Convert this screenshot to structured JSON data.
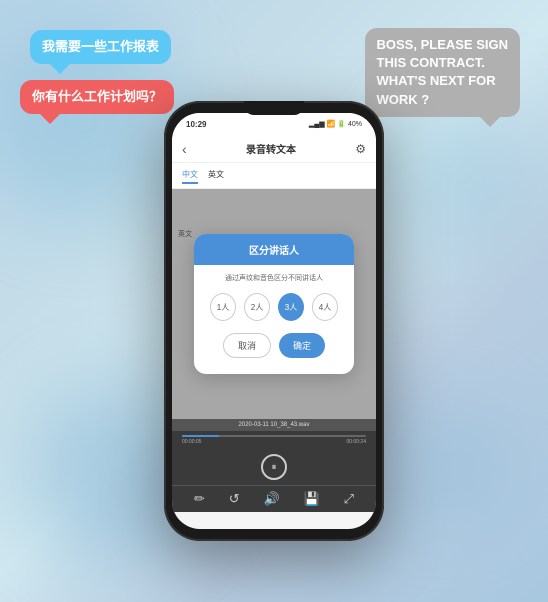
{
  "background": {
    "colors": [
      "#b8d4e8",
      "#c5dde8",
      "#d0e8f0"
    ]
  },
  "bubbles": {
    "left1": {
      "text": "我需要一些工作报表",
      "color": "#5bc8f5"
    },
    "left2": {
      "text": "你有什么工作计划吗？",
      "color": "#f06060"
    },
    "right": {
      "line1": "BOSS, PLEASE SIGN",
      "line2": "THIS CONTRACT.",
      "line3": "WHAT'S NEXT FOR",
      "line4": "WORK ?",
      "color": "#b0b0b0"
    }
  },
  "phone": {
    "statusBar": {
      "time": "10:29",
      "signal": "📶",
      "battery": "🔋 40%"
    },
    "nav": {
      "back": "‹",
      "title": "录音转文本",
      "gear": "⚙"
    },
    "langTabs": {
      "active": "中文",
      "inactive": "英文"
    },
    "dialog": {
      "title": "区分讲话人",
      "subtitle": "通过声纹和音色区分不同讲话人",
      "options": [
        "1人",
        "2人",
        "3人",
        "4人"
      ],
      "activeOption": 2,
      "cancelLabel": "取消",
      "confirmLabel": "确定"
    },
    "fileBar": {
      "fileName": "2020-03-11 10_38_43.wav"
    },
    "progress": {
      "currentTime": "00:00:05",
      "totalTime": "00:00:24",
      "fillPercent": 20
    },
    "controls": {
      "pause": "⏸",
      "rewind": "↺",
      "volume": "🔊",
      "save": "💾",
      "expand": "⤢"
    }
  }
}
